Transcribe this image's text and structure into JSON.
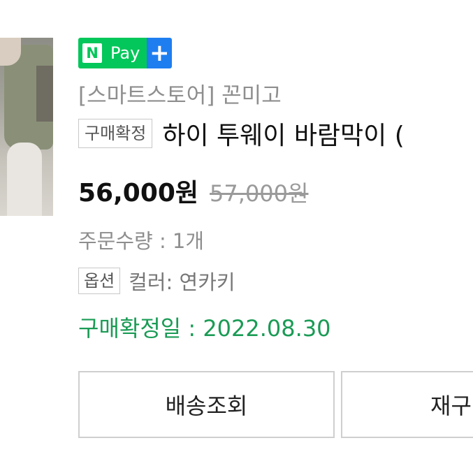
{
  "badge": {
    "n_letter": "N",
    "pay_label": "Pay",
    "plus": "+",
    "main_color": "#03c75a",
    "plus_color": "#1e7ef0"
  },
  "product": {
    "store": "[스마트스토어] 꼰미고",
    "status_tag": "구매확정",
    "title": "하이 투웨이 바람막이 (",
    "price": "56,000원",
    "original_price": "57,000원",
    "quantity": "주문수량 : 1개",
    "option_tag": "옵션",
    "option_value": "컬러: 연카키",
    "confirm_date": "구매확정일 : 2022.08.30"
  },
  "buttons": {
    "track": "배송조회",
    "second": "재구"
  },
  "colors": {
    "confirm_green": "#1a9b55",
    "muted_text": "#8e8e8e"
  }
}
